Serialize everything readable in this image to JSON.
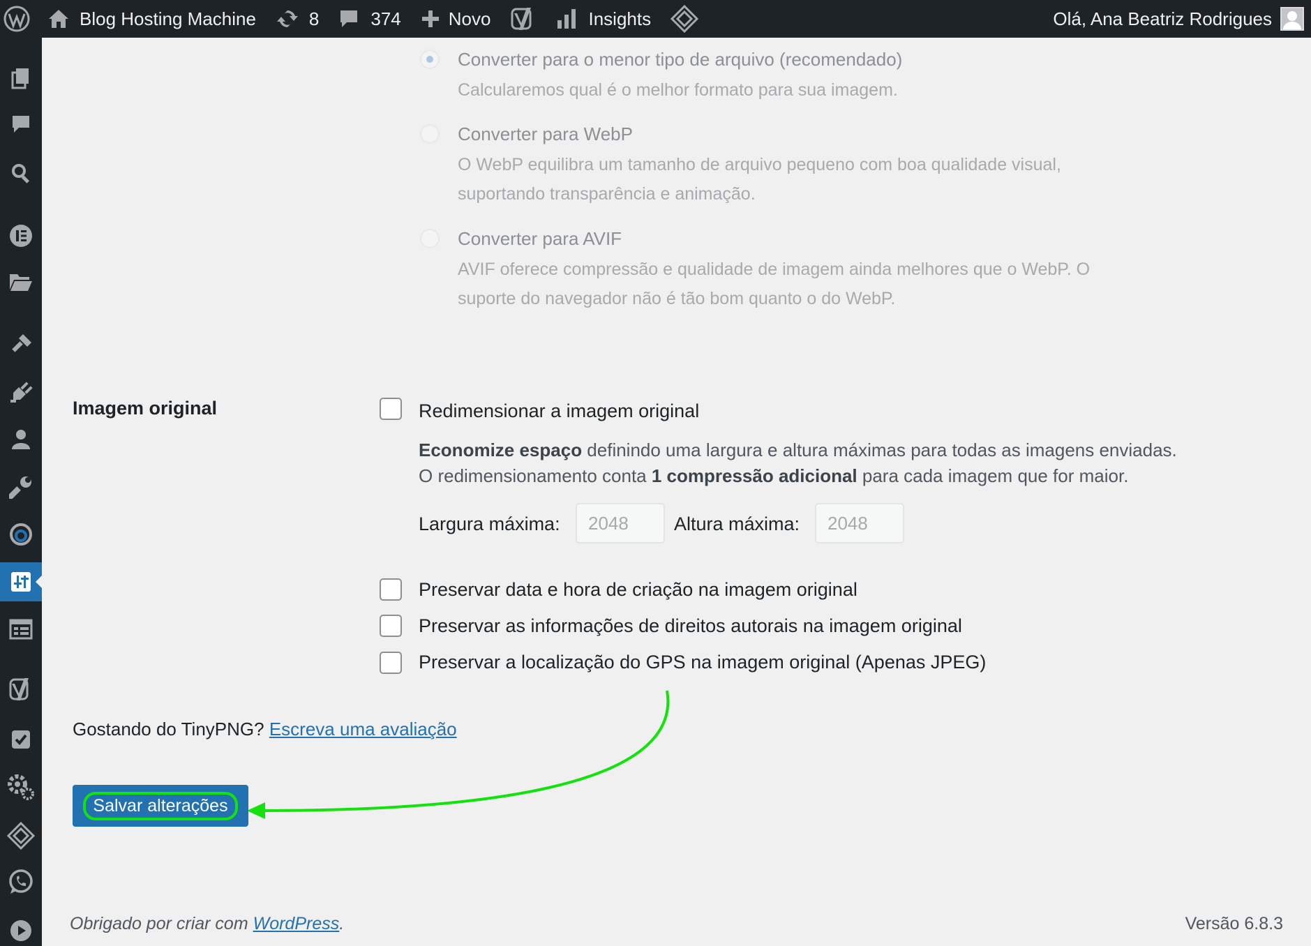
{
  "admin_bar": {
    "site_name": "Blog Hosting Machine",
    "updates_count": "8",
    "comments_count": "374",
    "new_label": "Novo",
    "insights_label": "Insights",
    "greeting": "Olá, Ana Beatriz Rodrigues"
  },
  "sidebar": {
    "icons": [
      "pages-icon",
      "comments-icon",
      "search-icon",
      "elementor-icon",
      "folder-icon",
      "appearance-icon",
      "plugins-icon",
      "users-icon",
      "tools-icon",
      "sync-icon",
      "settings-icon",
      "table-icon",
      "yoast-icon",
      "tasks-icon",
      "settings-cog-icon",
      "diamond-icon",
      "whatsapp-icon",
      "play-icon"
    ],
    "active": "settings-icon"
  },
  "conversion_options": [
    {
      "title": "Converter para o menor tipo de arquivo (recomendado)",
      "desc_lines": [
        "Calcularemos qual é o melhor formato para sua imagem."
      ],
      "checked": true
    },
    {
      "title": "Converter para WebP",
      "desc_lines": [
        "O WebP equilibra um tamanho de arquivo pequeno com boa qualidade visual,",
        "suportando transparência e animação."
      ],
      "checked": false
    },
    {
      "title": "Converter para AVIF",
      "desc_lines": [
        "AVIF oferece compressão e qualidade de imagem ainda melhores que o WebP. O",
        "suporte do navegador não é tão bom quanto o do WebP."
      ],
      "checked": false
    }
  ],
  "original_image": {
    "section_label": "Imagem original",
    "resize_label": "Redimensionar a imagem original",
    "desc_line1_bold": "Economize espaço",
    "desc_line1_rest": " definindo uma largura e altura máximas para todas as imagens enviadas.",
    "desc_line2_start": "O redimensionamento conta ",
    "desc_line2_bold": "1 compressão adicional",
    "desc_line2_end": " para cada imagem que for maior.",
    "max_width_label": "Largura máxima:",
    "max_width_value": "2048",
    "max_height_label": "Altura máxima:",
    "max_height_value": "2048",
    "preserve_date_label": "Preservar data e hora de criação na imagem original",
    "preserve_copyright_label": "Preservar as informações de direitos autorais na imagem original",
    "preserve_gps_label": "Preservar a localização do GPS na imagem original (Apenas JPEG)"
  },
  "rating": {
    "text": "Gostando do TinyPNG?",
    "link": "Escreva uma avaliação"
  },
  "save_button_label": "Salvar alterações",
  "annotation_color": "#14e20f",
  "footer": {
    "thanks_text": "Obrigado por criar com",
    "wordpress_link": "WordPress",
    "period": ".",
    "version": "Versão 6.8.3"
  }
}
